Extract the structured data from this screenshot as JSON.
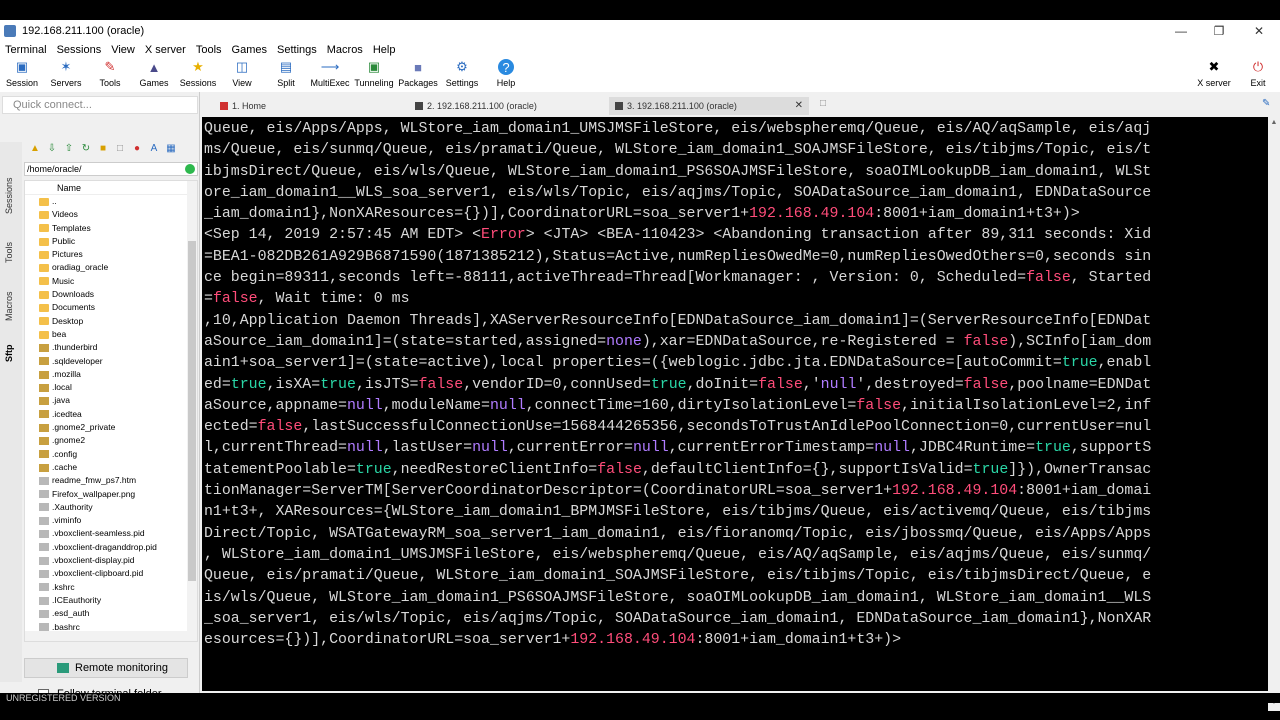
{
  "window": {
    "title": "192.168.211.100 (oracle)"
  },
  "menu": [
    "Terminal",
    "Sessions",
    "View",
    "X server",
    "Tools",
    "Games",
    "Settings",
    "Macros",
    "Help"
  ],
  "toolbar": {
    "left": [
      {
        "label": "Session",
        "icon": "monitor-icon"
      },
      {
        "label": "Servers",
        "icon": "servers-icon"
      },
      {
        "label": "Tools",
        "icon": "tools-icon"
      },
      {
        "label": "Games",
        "icon": "games-icon"
      },
      {
        "label": "Sessions",
        "icon": "star-icon"
      },
      {
        "label": "View",
        "icon": "view-icon"
      },
      {
        "label": "Split",
        "icon": "split-icon"
      },
      {
        "label": "MultiExec",
        "icon": "fork-icon"
      },
      {
        "label": "Tunneling",
        "icon": "tunnel-icon"
      },
      {
        "label": "Packages",
        "icon": "packages-icon"
      },
      {
        "label": "Settings",
        "icon": "gear-icon"
      },
      {
        "label": "Help",
        "icon": "help-icon"
      }
    ],
    "right": [
      {
        "label": "X server",
        "icon": "x-icon"
      },
      {
        "label": "Exit",
        "icon": "power-icon"
      }
    ]
  },
  "sidebar": {
    "quick_connect_placeholder": "Quick connect...",
    "vertical_tabs": [
      "Sessions",
      "Tools",
      "Macros",
      "Sftp"
    ],
    "path": "/home/oracle/",
    "column_name": "Name",
    "files": [
      {
        "name": "..",
        "type": "folder"
      },
      {
        "name": "Videos",
        "type": "folder"
      },
      {
        "name": "Templates",
        "type": "folder"
      },
      {
        "name": "Public",
        "type": "folder"
      },
      {
        "name": "Pictures",
        "type": "folder"
      },
      {
        "name": "oradiag_oracle",
        "type": "folder"
      },
      {
        "name": "Music",
        "type": "folder"
      },
      {
        "name": "Downloads",
        "type": "folder"
      },
      {
        "name": "Documents",
        "type": "folder"
      },
      {
        "name": "Desktop",
        "type": "folder"
      },
      {
        "name": "bea",
        "type": "folder"
      },
      {
        "name": ".thunderbird",
        "type": "dotfolder"
      },
      {
        "name": ".sqldeveloper",
        "type": "dotfolder"
      },
      {
        "name": ".mozilla",
        "type": "dotfolder"
      },
      {
        "name": ".local",
        "type": "dotfolder"
      },
      {
        "name": ".java",
        "type": "dotfolder"
      },
      {
        "name": ".icedtea",
        "type": "dotfolder"
      },
      {
        "name": ".gnome2_private",
        "type": "dotfolder"
      },
      {
        "name": ".gnome2",
        "type": "dotfolder"
      },
      {
        "name": ".config",
        "type": "dotfolder"
      },
      {
        "name": ".cache",
        "type": "dotfolder"
      },
      {
        "name": "readme_fmw_ps7.htm",
        "type": "file"
      },
      {
        "name": "Firefox_wallpaper.png",
        "type": "file"
      },
      {
        "name": ".Xauthority",
        "type": "file"
      },
      {
        "name": ".viminfo",
        "type": "file"
      },
      {
        "name": ".vboxclient-seamless.pid",
        "type": "file"
      },
      {
        "name": ".vboxclient-draganddrop.pid",
        "type": "file"
      },
      {
        "name": ".vboxclient-display.pid",
        "type": "file"
      },
      {
        "name": ".vboxclient-clipboard.pid",
        "type": "file"
      },
      {
        "name": ".kshrc",
        "type": "file"
      },
      {
        "name": ".ICEauthority",
        "type": "file"
      },
      {
        "name": ".esd_auth",
        "type": "file"
      },
      {
        "name": ".bashrc",
        "type": "file"
      }
    ],
    "remote_monitoring": "Remote monitoring",
    "follow_terminal_folder": "Follow terminal folder"
  },
  "tabs": [
    {
      "label": "1. Home",
      "icon": "home-icon",
      "active": false
    },
    {
      "label": "2. 192.168.211.100 (oracle)",
      "icon": "terminal-icon",
      "active": false
    },
    {
      "label": "3. 192.168.211.100 (oracle)",
      "icon": "terminal-icon",
      "active": true
    }
  ],
  "terminal": {
    "lines": [
      "Queue, eis/Apps/Apps, WLStore_iam_domain1_UMSJMSFileStore, eis/webspheremq/Queue, eis/AQ/aqSample, eis/aqj",
      "ms/Queue, eis/sunmq/Queue, eis/pramati/Queue, WLStore_iam_domain1_SOAJMSFileStore, eis/tibjms/Topic, eis/t",
      "ibjmsDirect/Queue, eis/wls/Queue, WLStore_iam_domain1_PS6SOAJMSFileStore, soaOIMLookupDB_iam_domain1, WLSt",
      "ore_iam_domain1__WLS_soa_server1, eis/wls/Topic, eis/aqjms/Topic, SOADataSource_iam_domain1, EDNDataSource",
      "_iam_domain1},NonXAResources={})],CoordinatorURL=soa_server1+192.168.49.104:8001+iam_domain1+t3+)>",
      "<Sep 14, 2019 2:57:45 AM EDT> <Error> <JTA> <BEA-110423> <Abandoning transaction after 89,311 seconds: Xid",
      "=BEA1-082DB261A929B6871590(1871385212),Status=Active,numRepliesOwedMe=0,numRepliesOwedOthers=0,seconds sin",
      "ce begin=89311,seconds left=-88111,activeThread=Thread[Workmanager: , Version: 0, Scheduled=false, Started",
      "=false, Wait time: 0 ms",
      ",10,Application Daemon Threads],XAServerResourceInfo[EDNDataSource_iam_domain1]=(ServerResourceInfo[EDNDat",
      "aSource_iam_domain1]=(state=started,assigned=none),xar=EDNDataSource,re-Registered = false),SCInfo[iam_dom",
      "ain1+soa_server1]=(state=active),local properties=({weblogic.jdbc.jta.EDNDataSource=[autoCommit=true,enabl",
      "ed=true,isXA=true,isJTS=false,vendorID=0,connUsed=true,doInit=false,'null',destroyed=false,poolname=EDNDat",
      "aSource,appname=null,moduleName=null,connectTime=160,dirtyIsolationLevel=false,initialIsolationLevel=2,inf",
      "ected=false,lastSuccessfulConnectionUse=1568444265356,secondsToTrustAnIdlePoolConnection=0,currentUser=nul",
      "l,currentThread=null,lastUser=null,currentError=null,currentErrorTimestamp=null,JDBC4Runtime=true,supportS",
      "tatementPoolable=true,needRestoreClientInfo=false,defaultClientInfo={},supportIsValid=true]}),OwnerTransac",
      "tionManager=ServerTM[ServerCoordinatorDescriptor=(CoordinatorURL=soa_server1+192.168.49.104:8001+iam_domai",
      "n1+t3+, XAResources={WLStore_iam_domain1_BPMJMSFileStore, eis/tibjms/Queue, eis/activemq/Queue, eis/tibjms",
      "Direct/Topic, WSATGatewayRM_soa_server1_iam_domain1, eis/fioranomq/Topic, eis/jbossmq/Queue, eis/Apps/Apps",
      ", WLStore_iam_domain1_UMSJMSFileStore, eis/webspheremq/Queue, eis/AQ/aqSample, eis/aqjms/Queue, eis/sunmq/",
      "Queue, eis/pramati/Queue, WLStore_iam_domain1_SOAJMSFileStore, eis/tibjms/Topic, eis/tibjmsDirect/Queue, e",
      "is/wls/Queue, WLStore_iam_domain1_PS6SOAJMSFileStore, soaOIMLookupDB_iam_domain1, WLStore_iam_domain1__WLS",
      "_soa_server1, eis/wls/Topic, eis/aqjms/Topic, SOADataSource_iam_domain1, EDNDataSource_iam_domain1},NonXAR",
      "esources={})],CoordinatorURL=soa_server1+192.168.49.104:8001+iam_domain1+t3+)>"
    ]
  },
  "colors": {
    "ip": "#ff4d7a",
    "true": "#2ad6a6",
    "false": "#ff4d7a",
    "null": "#b07cff",
    "text": "#d8d8d8"
  },
  "banner": "UNREGISTERED VERSION"
}
